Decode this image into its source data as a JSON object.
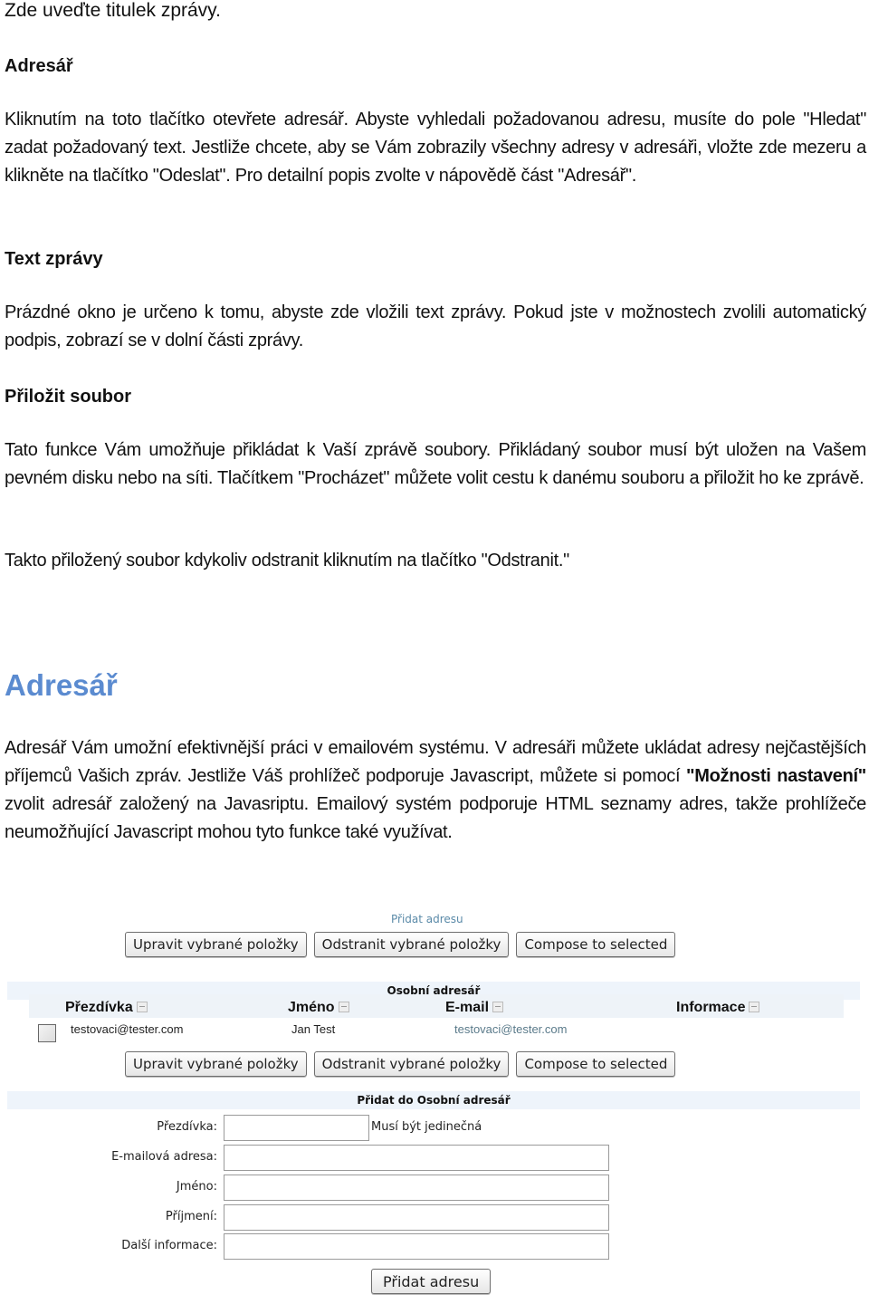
{
  "title_line": "Zde uveďte titulek zprávy.",
  "sections": [
    {
      "heading": "Adresář",
      "paragraphs": [
        "Kliknutím na toto tlačítko otevřete adresář. Abyste vyhledali požadovanou adresu, musíte do pole \"Hledat\" zadat požadovaný text. Jestliže chcete, aby se Vám zobrazily všechny adresy v adresáři, vložte zde mezeru a klikněte na tlačítko \"Odeslat\". Pro detailní popis zvolte v nápovědě část \"Adresář\"."
      ]
    },
    {
      "heading": "Text zprávy",
      "paragraphs": [
        "Prázdné okno je určeno k tomu, abyste zde vložili text zprávy. Pokud jste v možnostech zvolili automatický podpis, zobrazí se v dolní části zprávy."
      ]
    },
    {
      "heading": "Přiložit soubor",
      "paragraphs": [
        "Tato funkce Vám umožňuje přikládat k Vaší zprávě soubory. Přikládaný soubor musí být uložen na Vašem pevném disku nebo na síti. Tlačítkem \"Procházet\" můžete volit cestu k danému souboru a přiložit ho ke zprávě.",
        "Takto přiložený soubor kdykoliv odstranit kliknutím na tlačítko \"Odstranit.\""
      ]
    }
  ],
  "address_book_section": {
    "heading": "Adresář",
    "heading_color": "#5b8bd0",
    "paragraph_before_bold": "Adresář Vám umožní efektivnější práci v emailovém systému. V adresáři můžete ukládat adresy nejčastějších příjemců Vašich zpráv. Jestliže Váš prohlížeč podporuje Javascript, můžete si pomocí ",
    "paragraph_bold": "\"Možnosti nastavení\"",
    "paragraph_after_bold": " zvolit adresář založený na Javasriptu. Emailový systém podporuje HTML seznamy adres, takže prohlížeče neumožňující Javascript mohou tyto funkce také využívat."
  },
  "screenshot": {
    "add_address_link": "Přidat adresu",
    "buttons": {
      "edit_selected": "Upravit vybrané položky",
      "delete_selected": "Odstranit vybrané položky",
      "compose_to_selected": "Compose to selected"
    },
    "book_title": "Osobní adresář",
    "columns": [
      "Přezdívka",
      "Jméno",
      "E-mail",
      "Informace"
    ],
    "rows": [
      {
        "nickname": "testovaci@tester.com",
        "name": "Jan Test",
        "email": "testovaci@tester.com",
        "info": "",
        "checked": false
      }
    ],
    "add_form": {
      "title": "Přidat do Osobní adresář",
      "fields": [
        {
          "label": "Přezdívka:",
          "value": "",
          "hint": "Musí být jedinečná"
        },
        {
          "label": "E-mailová adresa:",
          "value": ""
        },
        {
          "label": "Jméno:",
          "value": ""
        },
        {
          "label": "Příjmení:",
          "value": ""
        },
        {
          "label": "Další informace:",
          "value": ""
        }
      ],
      "submit_label": "Přidat adresu"
    },
    "colors": {
      "link": "#5a8aa8",
      "header_bar": "#eef4fb",
      "email_text": "#5a7a8a"
    }
  }
}
